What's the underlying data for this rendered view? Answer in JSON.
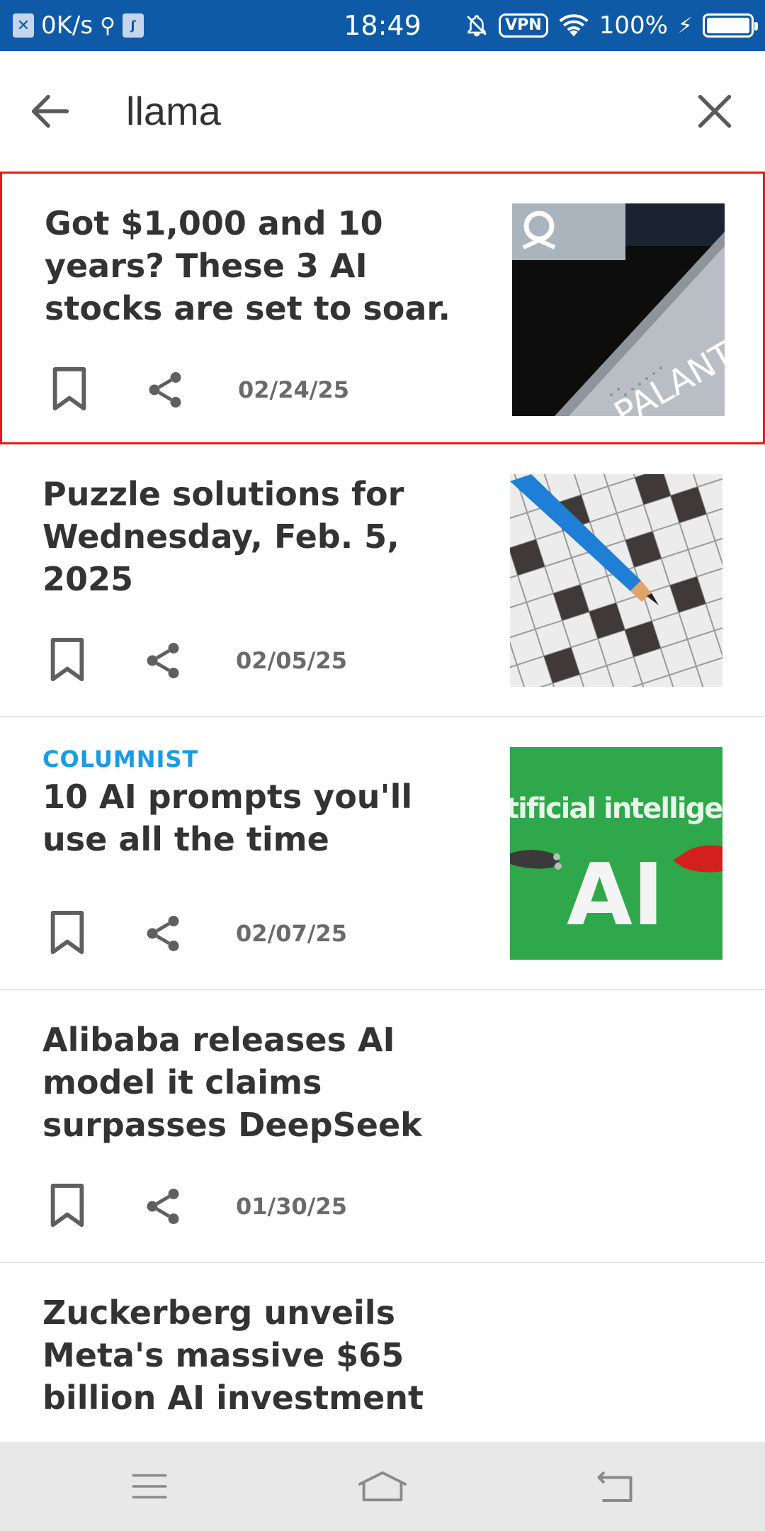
{
  "status_bar": {
    "network_speed": "0K/s",
    "time": "18:49",
    "vpn_label": "VPN",
    "battery": "100%"
  },
  "search": {
    "query": "llama"
  },
  "articles": [
    {
      "kicker": "",
      "headline": "Got $1,000 and 10 years? These 3 AI stocks are set to soar.",
      "date": "02/24/25",
      "image_text": "PALANT",
      "selected": true
    },
    {
      "kicker": "",
      "headline": "Puzzle solutions for Wednesday, Feb. 5, 2025",
      "date": "02/05/25"
    },
    {
      "kicker": "COLUMNIST",
      "headline": "10 AI prompts you'll use all the time",
      "date": "02/07/25",
      "image_text_top": "tificial intelligence",
      "image_text_main": "AI"
    },
    {
      "kicker": "",
      "headline": "Alibaba releases AI model it claims surpasses DeepSeek",
      "date": "01/30/25"
    },
    {
      "kicker": "",
      "headline": "Zuckerberg unveils Meta's massive $65 billion AI investment",
      "date": ""
    }
  ],
  "colors": {
    "status_bar": "#0f5aa6",
    "kicker": "#1a9be6",
    "selection": "#e31b1b"
  }
}
